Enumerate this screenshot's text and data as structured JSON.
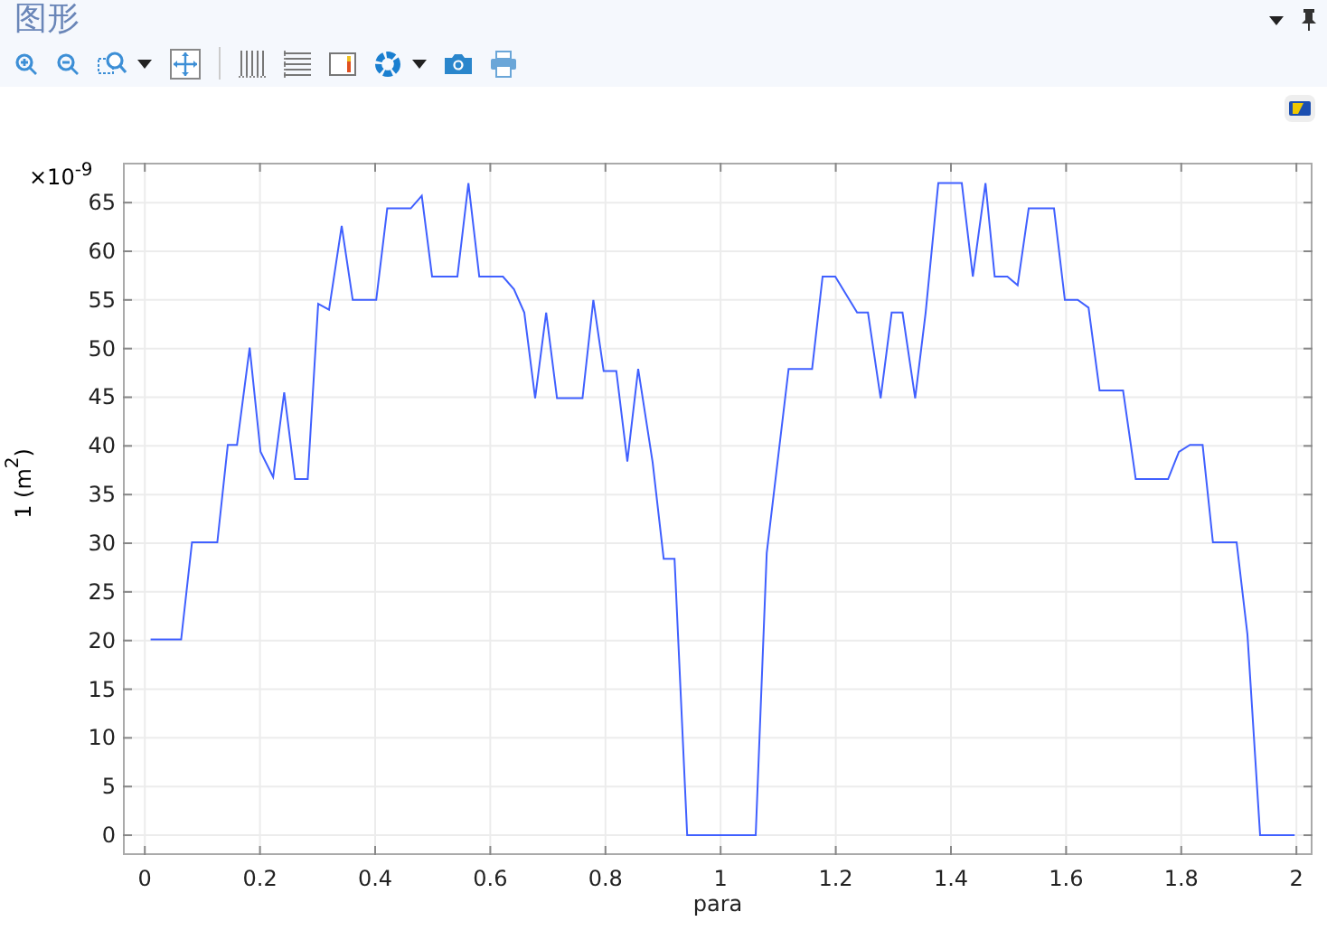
{
  "window": {
    "title": "图形"
  },
  "toolbar": {
    "items": [
      {
        "kind": "zoom-in"
      },
      {
        "kind": "zoom-out"
      },
      {
        "kind": "zoom-box",
        "dropdown": true
      },
      {
        "kind": "zoom-extents"
      },
      {
        "kind": "separator"
      },
      {
        "kind": "grid-vertical"
      },
      {
        "kind": "grid-horizontal"
      },
      {
        "kind": "legend"
      },
      {
        "kind": "color",
        "dropdown": true
      },
      {
        "kind": "camera"
      },
      {
        "kind": "print"
      }
    ]
  },
  "plot": {
    "multiplier": "×10$^{-9}$",
    "chart_data": {
      "type": "line",
      "xlabel": "para",
      "ylabel": "1 (m$^{2}$)",
      "xlim": [
        -0.038,
        2.028
      ],
      "ylim": [
        -2.04,
        69.1
      ],
      "xticks": [
        0,
        {
          "value": 0.2,
          "label": "0.2"
        },
        {
          "value": 0.4,
          "label": "0.4"
        },
        {
          "value": 0.6,
          "label": "0.6"
        },
        {
          "value": 0.8,
          "label": "0.8"
        },
        1,
        {
          "value": 1.2,
          "label": "1.2"
        },
        {
          "value": 1.4,
          "label": "1.4"
        },
        {
          "value": 1.6,
          "label": "1.6"
        },
        {
          "value": 1.8,
          "label": "1.8"
        },
        2
      ],
      "yticks": [
        0,
        5,
        10,
        15,
        20,
        25,
        30,
        35,
        40,
        45,
        50,
        55,
        60,
        65
      ],
      "x": [
        0.01,
        0.063,
        0.082,
        0.126,
        0.144,
        0.16,
        0.182,
        0.201,
        0.223,
        0.242,
        0.261,
        0.283,
        0.301,
        0.32,
        0.342,
        0.361,
        0.402,
        0.421,
        0.462,
        0.481,
        0.499,
        0.543,
        0.562,
        0.581,
        0.622,
        0.641,
        0.659,
        0.678,
        0.697,
        0.716,
        0.76,
        0.779,
        0.797,
        0.819,
        0.838,
        0.857,
        0.882,
        0.901,
        0.92,
        0.942,
        1.061,
        1.08,
        1.118,
        1.159,
        1.177,
        1.199,
        1.237,
        1.256,
        1.278,
        1.297,
        1.316,
        1.338,
        1.356,
        1.378,
        1.419,
        1.438,
        1.46,
        1.476,
        1.498,
        1.516,
        1.535,
        1.579,
        1.598,
        1.62,
        1.639,
        1.658,
        1.699,
        1.721,
        1.777,
        1.796,
        1.815,
        1.837,
        1.855,
        1.896,
        1.915,
        1.937,
        1.997
      ],
      "grid": true,
      "series": [
        {
          "color": "#4060ff",
          "values": [
            20.1,
            20.1,
            30.1,
            30.1,
            40.1,
            40.1,
            50.1,
            39.4,
            36.8,
            45.5,
            36.6,
            36.6,
            54.6,
            54,
            62.6,
            55,
            55,
            64.4,
            64.4,
            65.7,
            57.4,
            57.4,
            67,
            57.4,
            57.4,
            56.1,
            53.7,
            44.9,
            53.7,
            44.9,
            44.9,
            55,
            47.7,
            47.7,
            38.4,
            47.9,
            38.3,
            28.4,
            28.4,
            0,
            0,
            29,
            47.9,
            47.9,
            57.4,
            57.4,
            53.7,
            53.7,
            44.9,
            53.7,
            53.7,
            44.9,
            53.7,
            67,
            67,
            57.4,
            67,
            57.4,
            57.4,
            56.5,
            64.4,
            64.4,
            55,
            55,
            54.2,
            45.7,
            45.7,
            36.6,
            36.6,
            39.4,
            40.1,
            40.1,
            30.1,
            30.1,
            20.6,
            0,
            0
          ]
        }
      ]
    }
  }
}
